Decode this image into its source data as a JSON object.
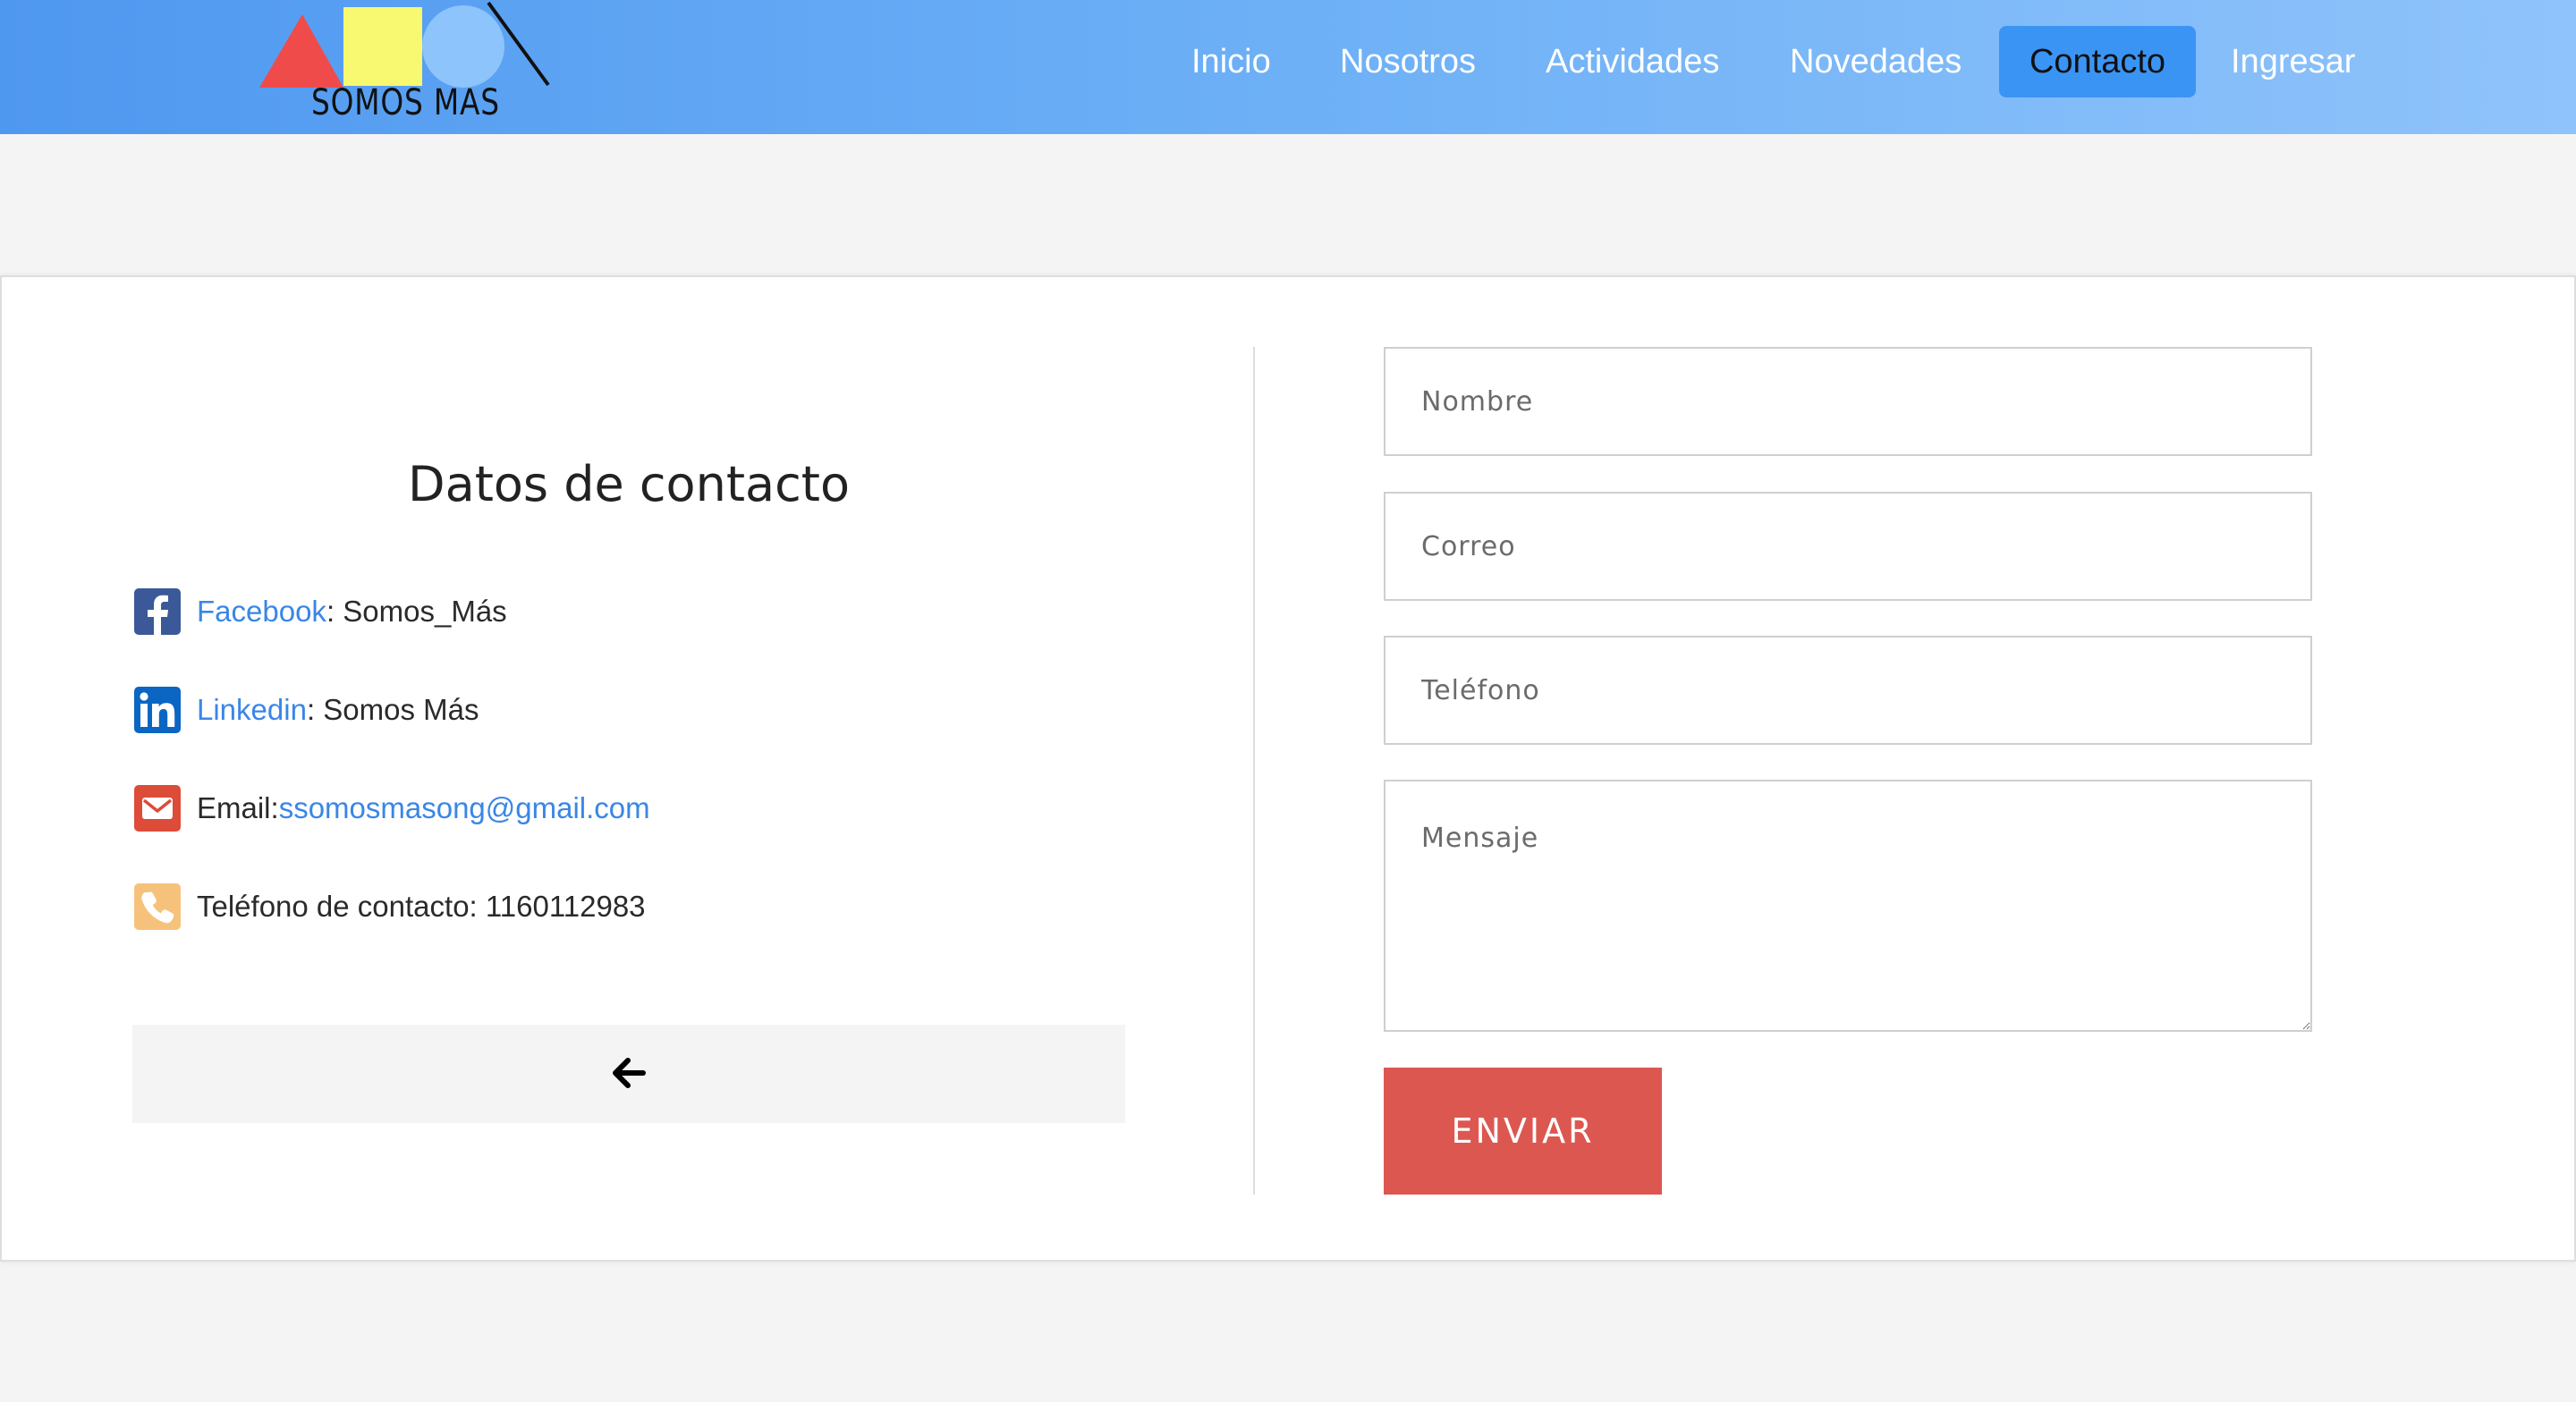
{
  "logo": {
    "text": "SOMOS MAS"
  },
  "nav": {
    "items": [
      {
        "label": "Inicio"
      },
      {
        "label": "Nosotros"
      },
      {
        "label": "Actividades"
      },
      {
        "label": "Novedades"
      },
      {
        "label": "Contacto",
        "active": true
      },
      {
        "label": "Ingresar"
      }
    ]
  },
  "contact": {
    "title": "Datos de contacto",
    "facebook": {
      "link": "Facebook",
      "value": ": Somos_Más",
      "icon": "facebook-icon"
    },
    "linkedin": {
      "link": "Linkedin",
      "value": ": Somos Más",
      "icon": "linkedin-icon"
    },
    "email": {
      "label": "Email:",
      "link": "ssomosmasong@gmail.com",
      "icon": "envelope-icon"
    },
    "phone": {
      "label": "Teléfono de contacto: 1160112983",
      "icon": "phone-icon"
    },
    "back_icon": "arrow-left-icon"
  },
  "form": {
    "name_placeholder": "Nombre",
    "email_placeholder": "Correo",
    "phone_placeholder": "Teléfono",
    "message_placeholder": "Mensaje",
    "submit_label": "ENVIAR"
  },
  "colors": {
    "header_gradient_start": "#4f98f0",
    "header_gradient_end": "#8fc3fb",
    "nav_active": "#3a94f4",
    "link": "#3a86e6",
    "submit": "#dd5751",
    "facebook": "#3b5998",
    "linkedin": "#0a66c2",
    "email": "#dd4b39",
    "phone": "#f6c27b"
  }
}
